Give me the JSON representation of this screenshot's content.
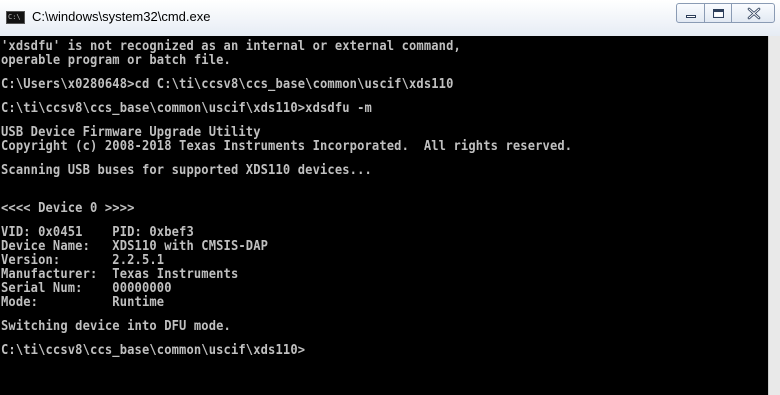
{
  "window": {
    "title": "C:\\windows\\system32\\cmd.exe",
    "icon": "cmd-icon",
    "icon_text": "C:\\"
  },
  "controls": {
    "minimize": "minimize-icon",
    "maximize": "maximize-icon",
    "close": "close-icon"
  },
  "console": {
    "lines": [
      "'xdsdfu' is not recognized as an internal or external command,",
      "operable program or batch file.",
      "",
      "C:\\Users\\x0280648>cd C:\\ti\\ccsv8\\ccs_base\\common\\uscif\\xds110",
      "",
      "C:\\ti\\ccsv8\\ccs_base\\common\\uscif\\xds110>xdsdfu -m",
      "",
      "USB Device Firmware Upgrade Utility",
      "Copyright (c) 2008-2018 Texas Instruments Incorporated.  All rights reserved.",
      "",
      "Scanning USB buses for supported XDS110 devices...",
      "",
      "",
      "<<<< Device 0 >>>>",
      "",
      "VID: 0x0451    PID: 0xbef3",
      "Device Name:   XDS110 with CMSIS-DAP",
      "Version:       2.2.5.1",
      "Manufacturer:  Texas Instruments",
      "Serial Num:    00000000",
      "Mode:          Runtime",
      "",
      "Switching device into DFU mode.",
      "",
      "C:\\ti\\ccsv8\\ccs_base\\common\\uscif\\xds110>"
    ]
  },
  "colors": {
    "console_bg": "#000000",
    "console_fg": "#c0c0c0"
  }
}
